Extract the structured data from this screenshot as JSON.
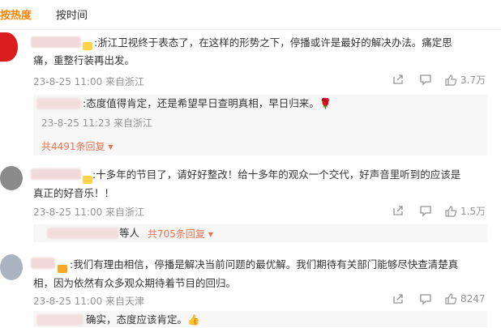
{
  "tabs": [
    {
      "label": "按热度"
    },
    {
      "label": "按时间"
    }
  ],
  "comments": [
    {
      "text_line1": ":浙江卫视终于表态了，在这样的形势之下，停播或许是最好的解决办法。痛定思",
      "text_line2": "痛，重整行装再出发。",
      "meta": "23-8-25 11:00 来自浙江",
      "likes": "3.7万",
      "reply": {
        "text": ":态度值得肯定，还是希望早日查明真相，早日归来。🌹",
        "meta": "23-8-25 11:23 来自浙江"
      },
      "more_replies": "共4491条回复"
    },
    {
      "text_line1": ":十多年的节目了，请好好整改！给十多年的观众一个交代，好声音里听到的应该是",
      "text_line2": "真正的好音乐！！",
      "meta": "23-8-25 11:00 来自浙江",
      "likes": "1.5万",
      "reply_summary": "等人",
      "more_replies": "共705条回复"
    },
    {
      "text_line1": ":我们有理由相信，停播是解决当前问题的最优解。我们期待有关部门能够尽快查清楚真",
      "text_line2": "相，因为依然有众多观众期待着节目的回归。",
      "meta": "23-8-25 11:00 来自天津",
      "likes": "8247",
      "reply": {
        "text": "确实，态度应该肯定。👍"
      }
    }
  ],
  "colors": {
    "accent": "#ff8200",
    "link": "#eb7350",
    "muted": "#939393"
  }
}
